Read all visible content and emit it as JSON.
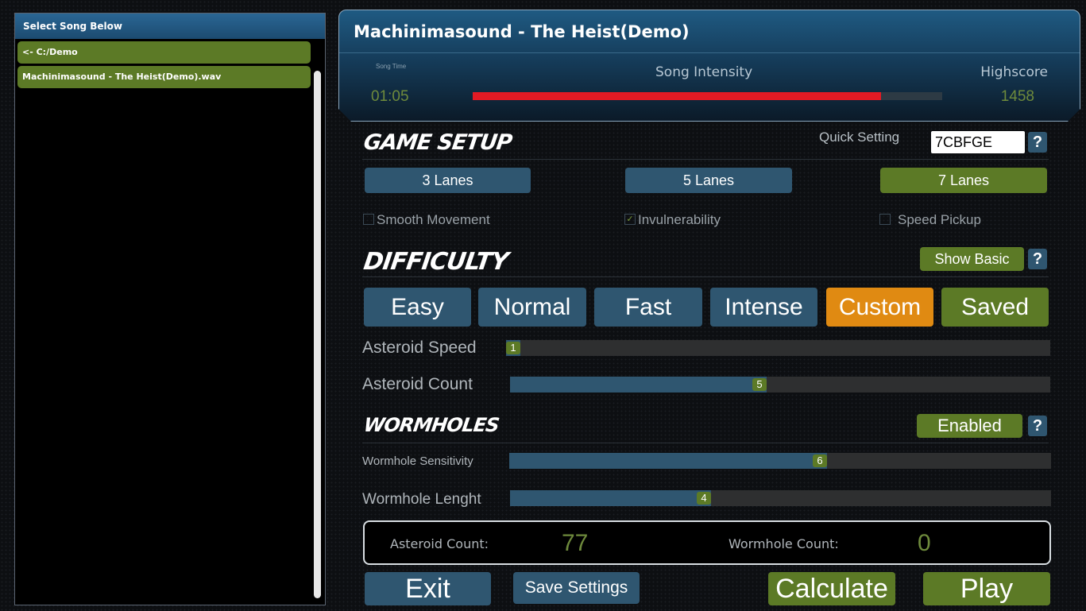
{
  "song_list": {
    "header": "Select Song Below",
    "items": [
      {
        "label": "<- C:/Demo"
      },
      {
        "label": "Machinimasound - The Heist(Demo).wav"
      }
    ]
  },
  "info": {
    "title": "Machinimasound - The Heist(Demo)",
    "song_time_label": "Song Time",
    "song_time": "01:05",
    "intensity_label": "Song Intensity",
    "intensity_fraction": 0.87,
    "highscore_label": "Highscore",
    "highscore": "1458"
  },
  "game_setup": {
    "title": "GAME SETUP",
    "quick_setting_label": "Quick Setting",
    "quick_setting_value": "7CBFGE",
    "help": "?",
    "lanes": [
      {
        "label": "3 Lanes",
        "selected": false
      },
      {
        "label": "5 Lanes",
        "selected": false
      },
      {
        "label": "7 Lanes",
        "selected": true
      }
    ],
    "options": [
      {
        "label": "Smooth Movement",
        "checked": false
      },
      {
        "label": "Invulnerability",
        "checked": true
      },
      {
        "label": "Speed Pickup",
        "checked": false
      }
    ]
  },
  "difficulty": {
    "title": "DIFFICULTY",
    "toggle_label": "Show Basic",
    "help": "?",
    "presets": [
      {
        "label": "Easy",
        "state": "normal"
      },
      {
        "label": "Normal",
        "state": "normal"
      },
      {
        "label": "Fast",
        "state": "normal"
      },
      {
        "label": "Intense",
        "state": "normal"
      },
      {
        "label": "Custom",
        "state": "active"
      },
      {
        "label": "Saved",
        "state": "saved"
      }
    ],
    "asteroid_speed": {
      "label": "Asteroid Speed",
      "value": "1",
      "fraction": 0.0
    },
    "asteroid_count": {
      "label": "Asteroid Count",
      "value": "5",
      "fraction": 0.46
    }
  },
  "wormholes": {
    "title": "WORMHOLES",
    "toggle_label": "Enabled",
    "help": "?",
    "sensitivity": {
      "label": "Wormhole Sensitivity",
      "value": "6",
      "fraction": 0.575
    },
    "length": {
      "label": "Wormhole Lenght",
      "value": "4",
      "fraction": 0.355
    }
  },
  "stats": {
    "asteroid_label": "Asteroid Count:",
    "asteroid_value": "77",
    "wormhole_label": "Wormhole Count:",
    "wormhole_value": "0"
  },
  "footer": {
    "exit": "Exit",
    "save": "Save Settings",
    "calculate": "Calculate",
    "play": "Play"
  }
}
